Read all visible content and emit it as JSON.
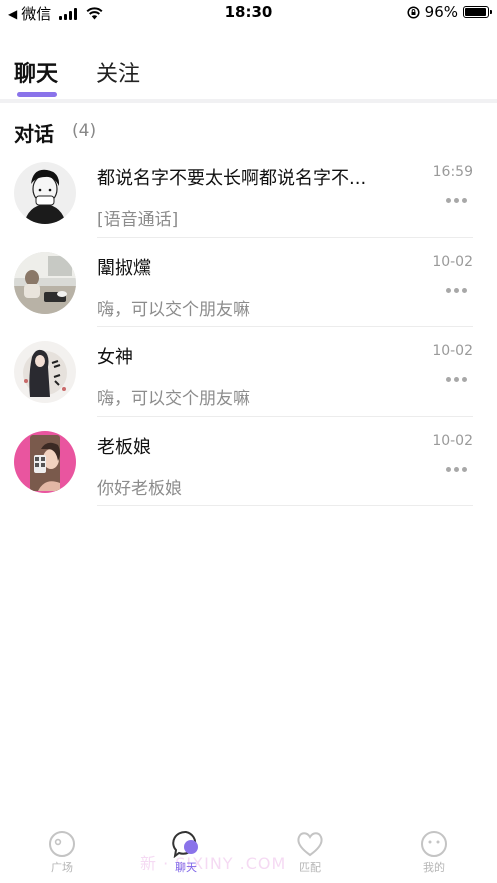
{
  "status_bar": {
    "back_app": "微信",
    "time": "18:30",
    "battery": "96%",
    "battery_level": 0.96
  },
  "tabs": [
    {
      "label": "聊天",
      "active": true
    },
    {
      "label": "关注",
      "active": false
    }
  ],
  "section": {
    "title": "对话",
    "count": "(4)"
  },
  "conversations": [
    {
      "name": "都说名字不要太长啊都说名字不...",
      "preview": "[语音通话]",
      "time": "16:59",
      "avatar": "avatar-boy-bw"
    },
    {
      "name": "闈掓爣",
      "preview": "嗨，可以交个朋友嘛",
      "time": "10-02",
      "avatar": "avatar-cafe"
    },
    {
      "name": "女神",
      "preview": "嗨，可以交个朋友嘛",
      "time": "10-02",
      "avatar": "avatar-goddess"
    },
    {
      "name": "老板娘",
      "preview": "你好老板娘",
      "time": "10-02",
      "avatar": "avatar-pink"
    }
  ],
  "bottom_nav": [
    {
      "label": "广场",
      "icon": "square-face-icon",
      "active": false
    },
    {
      "label": "聊天",
      "icon": "chat-bubble-icon",
      "active": true
    },
    {
      "label": "匹配",
      "icon": "heart-icon",
      "active": false
    },
    {
      "label": "我的",
      "icon": "smile-face-icon",
      "active": false
    }
  ],
  "watermark": "新 · SIXINY .COM",
  "colors": {
    "accent": "#8a73ea",
    "active_nav": "#7e64e8",
    "inactive_nav": "#b5b5b5",
    "muted_text": "#8c8c8c"
  }
}
